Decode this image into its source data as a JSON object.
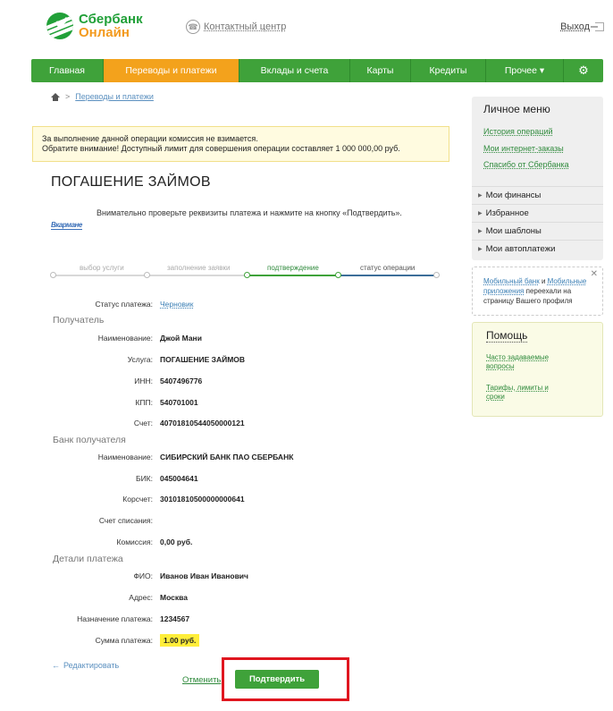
{
  "header": {
    "logo_line1": "Сбербанк",
    "logo_line2": "Онлайн",
    "contact_center": "Контактный центр",
    "exit": "Выход"
  },
  "nav": {
    "items": [
      "Главная",
      "Переводы и платежи",
      "Вклады и счета",
      "Карты",
      "Кредиты",
      "Прочее ▾"
    ],
    "active_index": 1
  },
  "breadcrumb": {
    "separator": ">",
    "link": "Переводы и платежи"
  },
  "notice": {
    "line1": "За выполнение данной операции комиссия не взимается.",
    "line2": "Обратите внимание! Доступный лимит для совершения операции составляет 1 000 000,00 руб."
  },
  "page_title": "ПОГАШЕНИЕ ЗАЙМОВ",
  "instruction": "Внимательно проверьте реквизиты платежа и нажмите на кнопку «Подтвердить».",
  "brand_badge": "Вкармане",
  "steps": [
    {
      "label": "выбор услуги",
      "state": "done"
    },
    {
      "label": "заполнение заявки",
      "state": "done"
    },
    {
      "label": "подтверждение",
      "state": "active"
    },
    {
      "label": "статус операции",
      "state": "pending"
    }
  ],
  "status": {
    "label": "Статус платежа:",
    "value": "Черновик"
  },
  "recipient": {
    "heading": "Получатель",
    "fields": [
      {
        "label": "Наименование:",
        "value": "Джой Мани"
      },
      {
        "label": "Услуга:",
        "value": "ПОГАШЕНИЕ ЗАЙМОВ"
      },
      {
        "label": "ИНН:",
        "value": "5407496776"
      },
      {
        "label": "КПП:",
        "value": "540701001"
      },
      {
        "label": "Счет:",
        "value": "40701810544050000121"
      }
    ]
  },
  "bank": {
    "heading": "Банк получателя",
    "fields": [
      {
        "label": "Наименование:",
        "value": "СИБИРСКИЙ БАНК ПАО СБЕРБАНК"
      },
      {
        "label": "БИК:",
        "value": "045004641"
      },
      {
        "label": "Корсчет:",
        "value": "30101810500000000641"
      },
      {
        "label": "Счет списания:",
        "value": ""
      },
      {
        "label": "Комиссия:",
        "value": "0,00 руб."
      }
    ]
  },
  "details": {
    "heading": "Детали платежа",
    "fields": [
      {
        "label": "ФИО:",
        "value": "Иванов Иван Иванович"
      },
      {
        "label": "Адрес:",
        "value": "Москва"
      },
      {
        "label": "Назначение платежа:",
        "value": "1234567"
      },
      {
        "label": "Сумма платежа:",
        "value": "1.00 руб."
      }
    ]
  },
  "actions": {
    "edit": "Редактировать",
    "cancel": "Отменить",
    "confirm": "Подтвердить"
  },
  "sidebar": {
    "title": "Личное меню",
    "links": [
      "История операций",
      "Мои интернет-заказы",
      "Спасибо от Сбербанка"
    ],
    "sections": [
      "Мои финансы",
      "Избранное",
      "Мои шаблоны",
      "Мои автоплатежи"
    ],
    "info": {
      "link1": "Мобильный банк",
      "and": " и ",
      "link2": "Мобильные приложения",
      "rest": " переехали на страницу Вашего профиля"
    },
    "help": {
      "title": "Помощь",
      "links": [
        "Часто задаваемые вопросы",
        "Тарифы, лимиты и сроки"
      ]
    }
  },
  "colors": {
    "brand_green": "#3fa23a",
    "active_orange": "#f3a21c",
    "highlight_yellow": "#ffee3a",
    "frame_red": "#e0161f"
  }
}
